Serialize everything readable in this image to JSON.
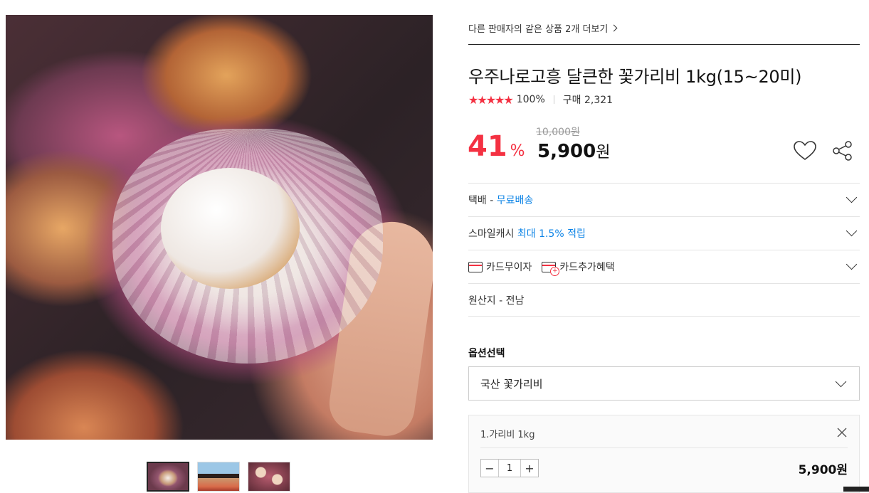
{
  "gallery": {
    "main_image_alt": "scallop",
    "thumbnails": [
      {
        "name": "thumbnail-scallop-hand"
      },
      {
        "name": "thumbnail-fisherman"
      },
      {
        "name": "thumbnail-scallops-pile"
      }
    ]
  },
  "product": {
    "other_sellers_link": "다른 판매자의 같은 상품 2개 더보기",
    "title": "우주나로고흥 달큰한 꽃가리비 1kg(15~20미)",
    "rating": {
      "stars": "★★★★★",
      "percent": "100%"
    },
    "purchase_count": "구매 2,321",
    "original_price": "10,000원",
    "discount_rate": "41",
    "discount_unit": "%",
    "sale_price": "5,900",
    "sale_price_unit": "원"
  },
  "info_rows": {
    "delivery_label": "택배 - ",
    "delivery_value": "무료배송",
    "smilecash_label": "스마일캐시 ",
    "smilecash_value": "최대 1.5% 적립",
    "card_interest_free": "카드무이자",
    "card_benefits": "카드추가혜택",
    "origin": "원산지 - 전남"
  },
  "options": {
    "section_label": "옵션선택",
    "selected_value": "국산 꽃가리비",
    "selected_item": {
      "name": "1.가리비 1kg",
      "quantity": "1",
      "price": "5,900원"
    }
  },
  "colors": {
    "accent_red": "#f43142",
    "link_blue": "#0b83e6"
  }
}
